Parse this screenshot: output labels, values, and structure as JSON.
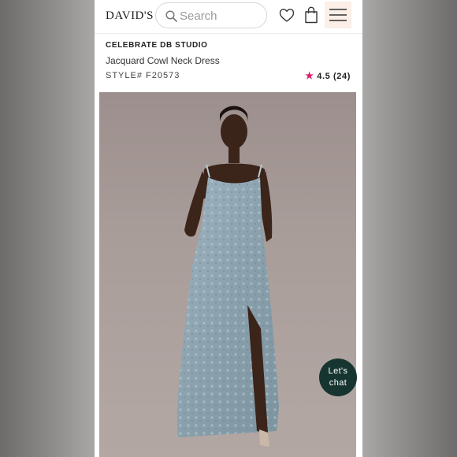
{
  "header": {
    "logo_text": "DAVID'S",
    "search_placeholder": "Search",
    "icons": [
      "search-icon",
      "heart-icon",
      "bag-icon",
      "menu-icon"
    ],
    "accent_color": "#fbefe8"
  },
  "product": {
    "brand": "CELEBRATE DB STUDIO",
    "name": "Jacquard Cowl Neck Dress",
    "style": "STYLE# F20573",
    "rating_value": "4.5",
    "rating_count": "(24)",
    "star_color": "#d61f6a"
  },
  "chat": {
    "line1": "Let's",
    "line2": "chat"
  }
}
